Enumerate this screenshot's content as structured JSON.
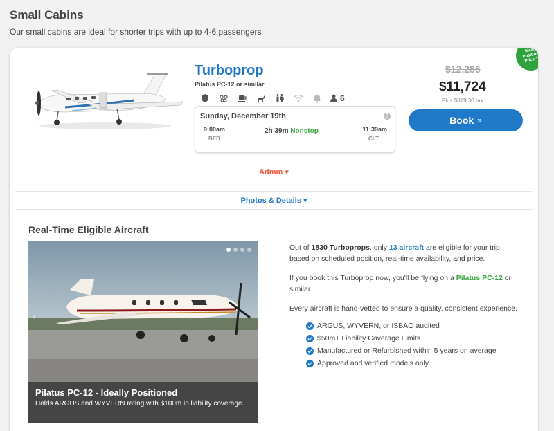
{
  "section": {
    "title": "Small Cabins",
    "subtitle": "Our small cabins are ideal for shorter trips with up to 4-6 passengers"
  },
  "cabin": {
    "title": "Turboprop",
    "model": "Pilatus PC-12 or similar",
    "passengers": "6",
    "amenities": [
      "shield-icon",
      "paw-icon",
      "coffee-icon",
      "pet-icon",
      "restroom-icon",
      "wifi-icon",
      "bell-icon",
      "person-icon"
    ]
  },
  "flight": {
    "date": "Sunday, December 19th",
    "depart_time": "9:00am",
    "depart_code": "BED",
    "arrive_time": "11:39am",
    "arrive_code": "CLT",
    "duration": "2h 39m",
    "stops": "Nonstop"
  },
  "pricing": {
    "old_price": "$12,286",
    "price": "$11,724",
    "tax": "Plus $879.30 tax",
    "book_label": "Book",
    "book_chevron": "»",
    "badge_lines": [
      "Ideal",
      "Position",
      "Price™"
    ]
  },
  "admin": {
    "label": "Admin ▾"
  },
  "photos": {
    "label": "Photos & Details ▾"
  },
  "realtime": {
    "title": "Real-Time Eligible Aircraft",
    "photo_caption_title": "Pilatus PC-12 - Ideally Positioned",
    "photo_caption_text": "Holds ARGUS and WYVERN rating with $100m in liability coverage.",
    "para1_pre": "Out of ",
    "para1_count": "1830 Turboprops",
    "para1_mid": ", only ",
    "para1_eligible": "13 aircraft",
    "para1_post": " are eligible for your trip based on scheduled position, real-time availability, and price.",
    "para2_pre": "If you book this Turboprop now, you'll be flying on a ",
    "para2_model": "Pilatus PC-12",
    "para2_post": " or similar.",
    "para3": "Every aircraft is hand-vetted to ensure a quality, consistent experience.",
    "checks": [
      "ARGUS, WYVERN, or ISBAO audited",
      "$50m+ Liability Coverage Limits",
      "Manufactured or Refurbished within 5 years on average",
      "Approved and verified models only"
    ]
  },
  "colors": {
    "brand_blue": "#1f78c8",
    "green": "#3aa642",
    "admin_red": "#ea5a3c"
  }
}
